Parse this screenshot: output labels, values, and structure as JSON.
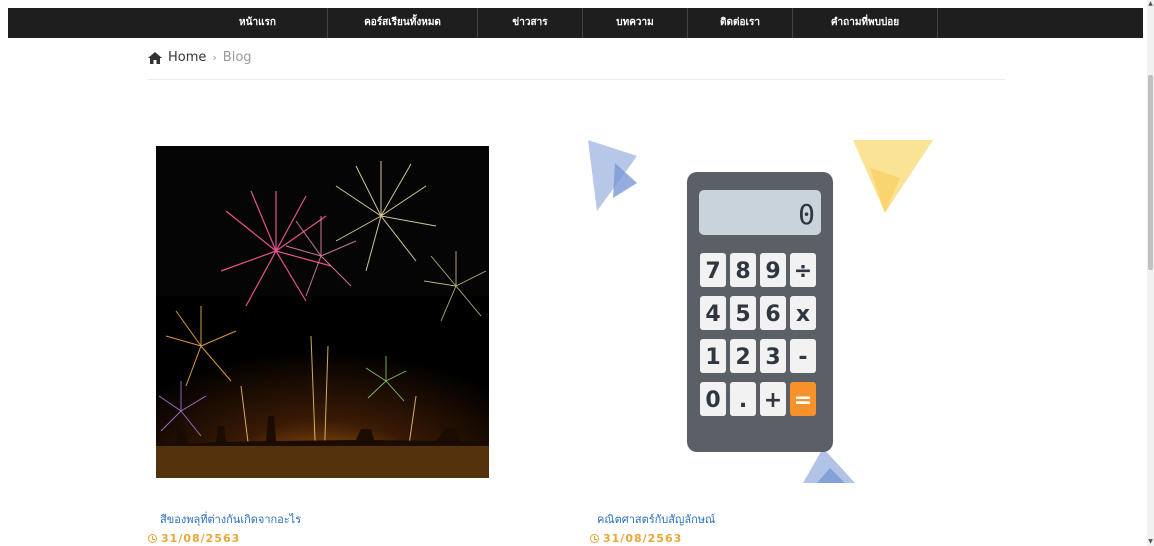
{
  "nav": {
    "items": [
      {
        "label": "หน้าแรก"
      },
      {
        "label": "คอร์สเรียนทั้งหมด"
      },
      {
        "label": "ข่าวสาร"
      },
      {
        "label": "บทความ"
      },
      {
        "label": "ติดต่อเรา"
      },
      {
        "label": "คำถามที่พบบ่อย"
      }
    ]
  },
  "breadcrumb": {
    "home": "Home",
    "separator": "›",
    "current": "Blog"
  },
  "posts": [
    {
      "title": "สีของพลุที่ต่างกันเกิดจากอะไร",
      "date": "31/08/2563",
      "image": "fireworks-image"
    },
    {
      "title": "คณิตศาสตร์กับสัญลักษณ์",
      "date": "31/08/2563",
      "image": "calculator-illustration"
    }
  ],
  "calculator": {
    "display": "0",
    "keys": [
      "7",
      "8",
      "9",
      "÷",
      "4",
      "5",
      "6",
      "x",
      "1",
      "2",
      "3",
      "-",
      "0",
      ".",
      "+",
      "="
    ]
  },
  "colors": {
    "nav_bg": "#1e1e1e",
    "link": "#2a6fbf",
    "date": "#e8a73a",
    "equals_key": "#f5932a"
  }
}
